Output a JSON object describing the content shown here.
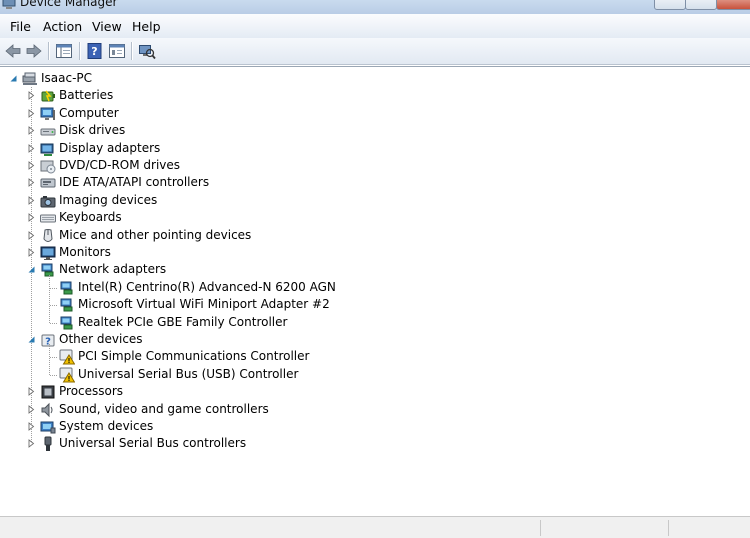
{
  "window": {
    "title": "Device Manager"
  },
  "menu": {
    "items": [
      "File",
      "Action",
      "View",
      "Help"
    ]
  },
  "toolbar": {
    "buttons": [
      "back-icon",
      "forward-icon",
      "console-tree-icon",
      "help-icon",
      "properties-icon",
      "scan-hardware-icon"
    ]
  },
  "tree": {
    "root": {
      "label": "Isaac-PC",
      "icon": "computer-root-icon"
    },
    "categories": [
      {
        "label": "Batteries",
        "icon": "battery-icon",
        "expanded": false
      },
      {
        "label": "Computer",
        "icon": "computer-icon",
        "expanded": false
      },
      {
        "label": "Disk drives",
        "icon": "disk-drive-icon",
        "expanded": false
      },
      {
        "label": "Display adapters",
        "icon": "display-adapter-icon",
        "expanded": false
      },
      {
        "label": "DVD/CD-ROM drives",
        "icon": "dvd-drive-icon",
        "expanded": false
      },
      {
        "label": "IDE ATA/ATAPI controllers",
        "icon": "ide-controller-icon",
        "expanded": false
      },
      {
        "label": "Imaging devices",
        "icon": "camera-icon",
        "expanded": false
      },
      {
        "label": "Keyboards",
        "icon": "keyboard-icon",
        "expanded": false
      },
      {
        "label": "Mice and other pointing devices",
        "icon": "mouse-icon",
        "expanded": false
      },
      {
        "label": "Monitors",
        "icon": "monitor-icon",
        "expanded": false
      },
      {
        "label": "Network adapters",
        "icon": "network-adapter-icon",
        "expanded": true,
        "children": [
          {
            "label": "Intel(R) Centrino(R) Advanced-N 6200 AGN",
            "icon": "network-adapter-icon",
            "warning": false
          },
          {
            "label": "Microsoft Virtual WiFi Miniport Adapter #2",
            "icon": "network-adapter-icon",
            "warning": false
          },
          {
            "label": "Realtek PCIe GBE Family Controller",
            "icon": "network-adapter-icon",
            "warning": false
          }
        ]
      },
      {
        "label": "Other devices",
        "icon": "unknown-device-icon",
        "expanded": true,
        "children": [
          {
            "label": "PCI Simple Communications Controller",
            "icon": "warning-device-icon",
            "warning": true
          },
          {
            "label": "Universal Serial Bus (USB) Controller",
            "icon": "warning-device-icon",
            "warning": true
          }
        ]
      },
      {
        "label": "Processors",
        "icon": "processor-icon",
        "expanded": false
      },
      {
        "label": "Sound, video and game controllers",
        "icon": "speaker-icon",
        "expanded": false
      },
      {
        "label": "System devices",
        "icon": "system-device-icon",
        "expanded": false
      },
      {
        "label": "Universal Serial Bus controllers",
        "icon": "usb-icon",
        "expanded": false
      }
    ]
  },
  "colors": {
    "accent": "#2a7ab0",
    "warning": "#f2c200",
    "tree_lines": "#a0a0a0"
  }
}
